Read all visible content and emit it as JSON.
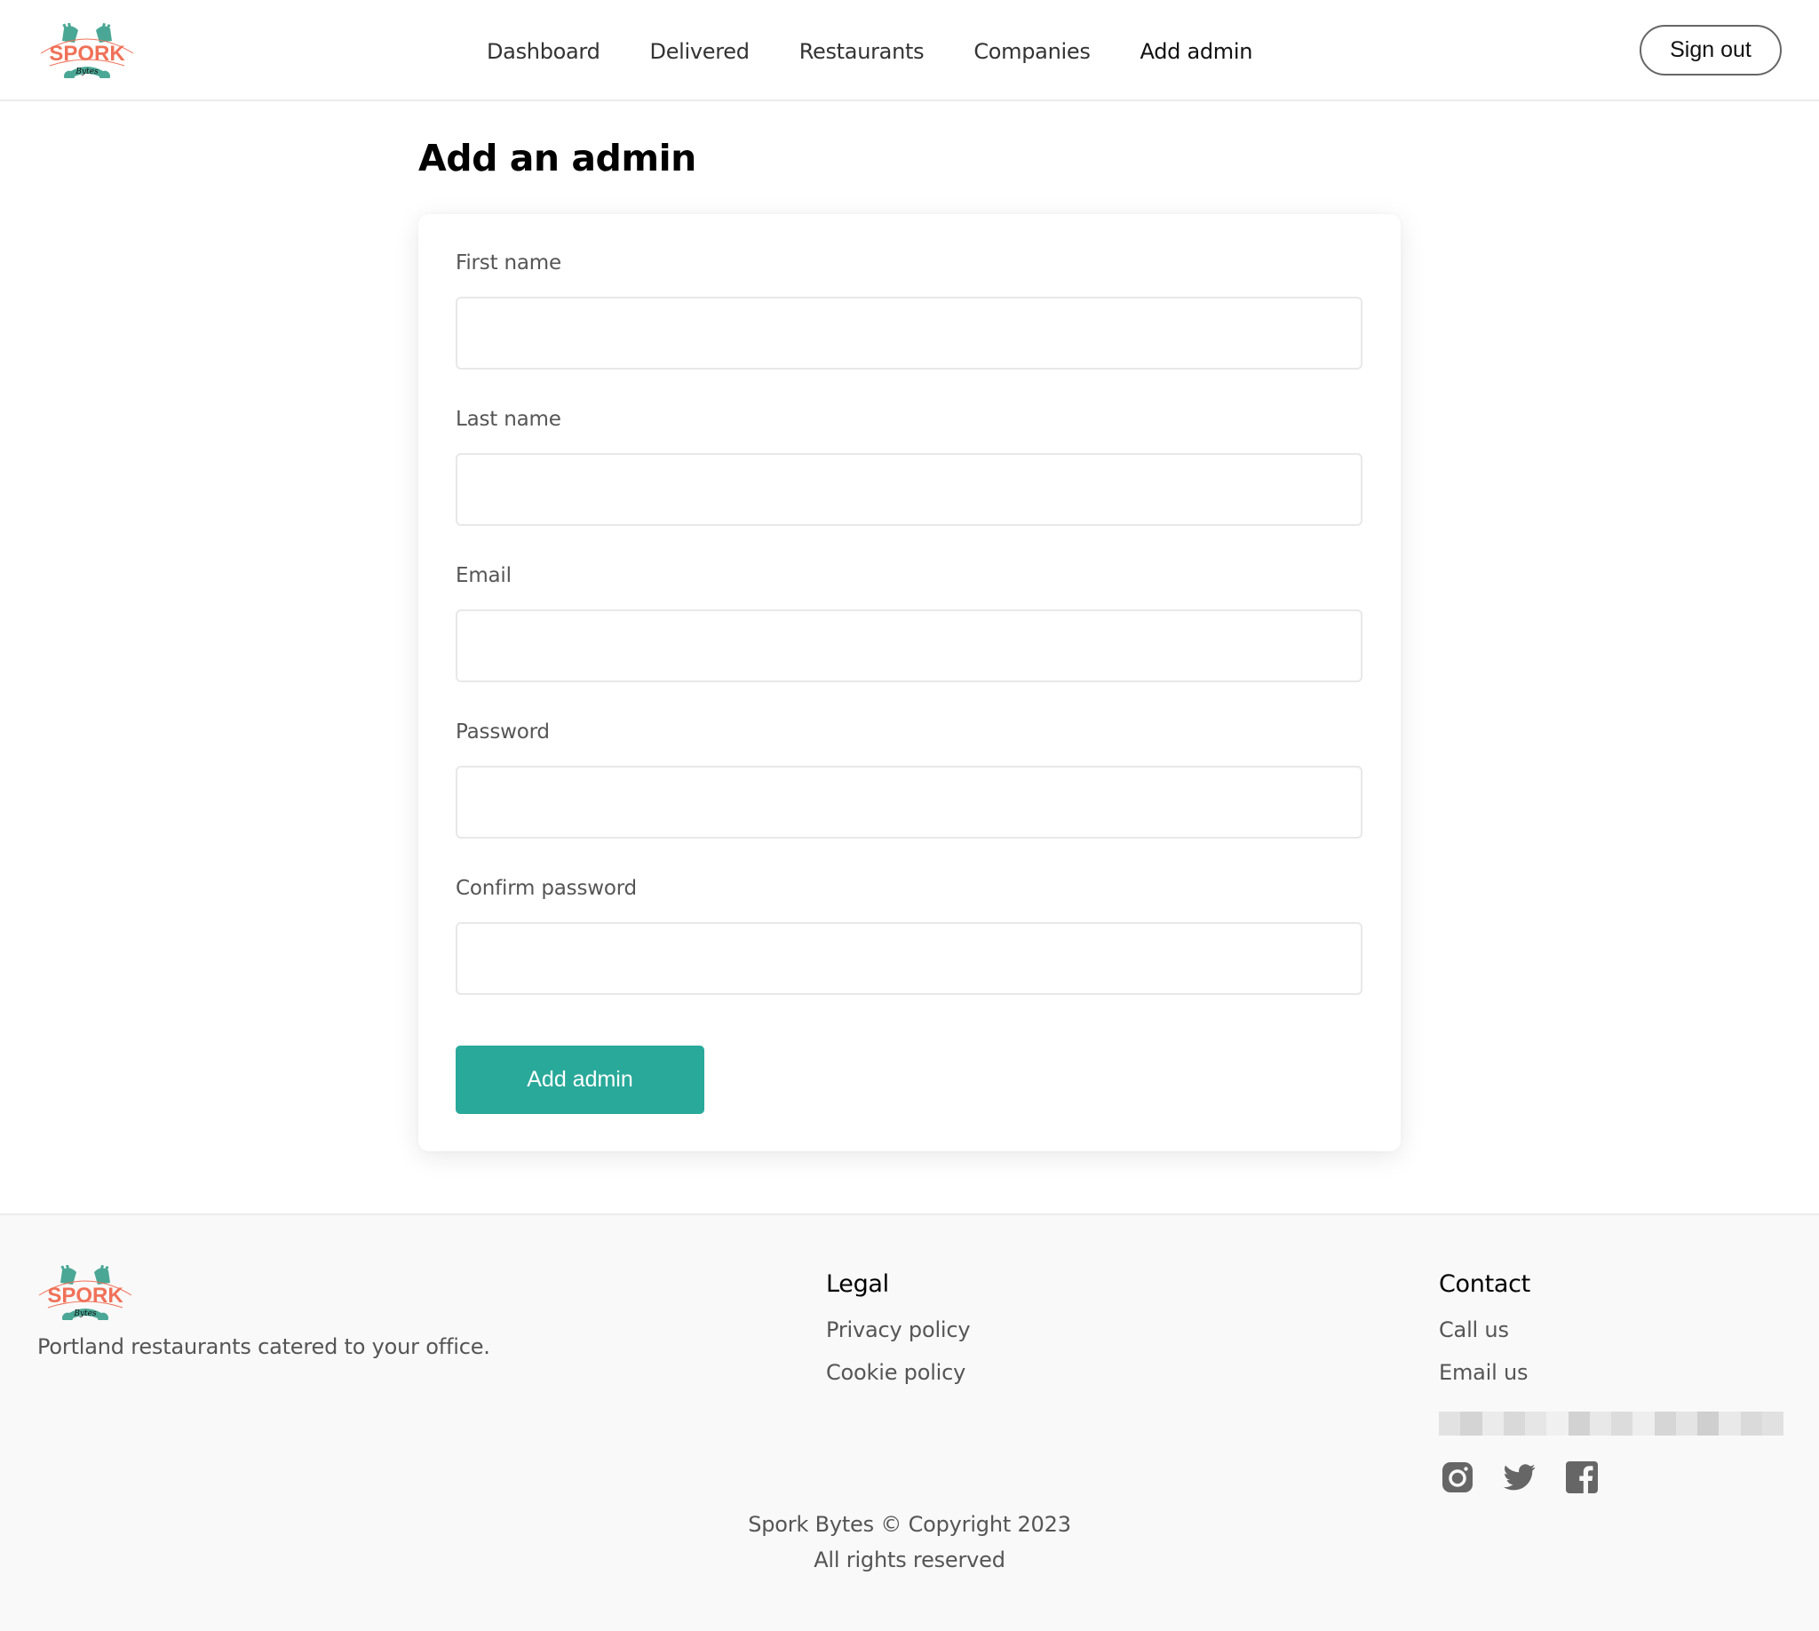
{
  "brand": {
    "name": "Spork Bytes",
    "logo_word": "SPORK",
    "logo_sub": "Bytes",
    "colors": {
      "teal": "#4aa795",
      "coral": "#f07158",
      "primary_button": "#28a99a"
    }
  },
  "header": {
    "nav": [
      {
        "label": "Dashboard",
        "active": false
      },
      {
        "label": "Delivered",
        "active": false
      },
      {
        "label": "Restaurants",
        "active": false
      },
      {
        "label": "Companies",
        "active": false
      },
      {
        "label": "Add admin",
        "active": true
      }
    ],
    "sign_out_label": "Sign out"
  },
  "main": {
    "title": "Add an admin",
    "form": {
      "fields": [
        {
          "label": "First name",
          "value": "",
          "type": "text"
        },
        {
          "label": "Last name",
          "value": "",
          "type": "text"
        },
        {
          "label": "Email",
          "value": "",
          "type": "email"
        },
        {
          "label": "Password",
          "value": "",
          "type": "password"
        },
        {
          "label": "Confirm password",
          "value": "",
          "type": "password"
        }
      ],
      "submit_label": "Add admin"
    }
  },
  "footer": {
    "tagline": "Portland restaurants catered to your office.",
    "legal": {
      "heading": "Legal",
      "links": [
        "Privacy policy",
        "Cookie policy"
      ]
    },
    "contact": {
      "heading": "Contact",
      "links": [
        "Call us",
        "Email us"
      ],
      "redacted_line": "[redacted]"
    },
    "social": [
      "instagram-icon",
      "twitter-icon",
      "facebook-icon"
    ],
    "copyright_line1": "Spork Bytes © Copyright 2023",
    "copyright_line2": "All rights reserved"
  }
}
